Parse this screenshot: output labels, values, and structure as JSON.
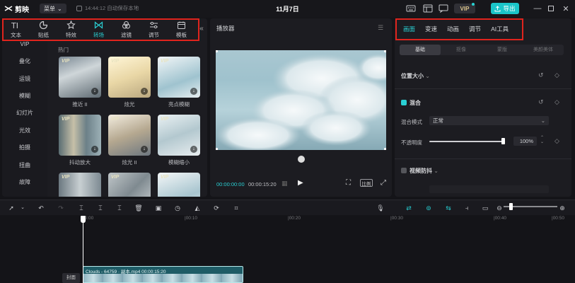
{
  "titlebar": {
    "app_name": "剪映",
    "menu_label": "菜单",
    "autosave": "14:44:12 自动保存本地",
    "date": "11月7日",
    "vip": "VIP",
    "export_label": "导出"
  },
  "left": {
    "tabs": [
      {
        "label": "文本",
        "icon": "text-icon"
      },
      {
        "label": "贴纸",
        "icon": "sticker-icon"
      },
      {
        "label": "特效",
        "icon": "effects-icon"
      },
      {
        "label": "转场",
        "icon": "transition-icon"
      },
      {
        "label": "滤镜",
        "icon": "filter-icon"
      },
      {
        "label": "调节",
        "icon": "adjust-icon"
      },
      {
        "label": "模板",
        "icon": "template-icon"
      }
    ],
    "active_tab": 3,
    "categories": [
      "VIP",
      "叠化",
      "运镜",
      "模糊",
      "幻灯片",
      "光效",
      "拍摄",
      "扭曲",
      "故障"
    ],
    "section": "热门",
    "thumbs": [
      "推近 II",
      "炫光",
      "亮点模糊",
      "抖动放大",
      "炫光 II",
      "模糊缩小"
    ],
    "vip_thumb_label": "VIP"
  },
  "player": {
    "title": "播放器",
    "time_current": "00:00:00:00",
    "time_total": "00:00:15:20",
    "ratio": "比例"
  },
  "right": {
    "tabs": [
      "画面",
      "变速",
      "动画",
      "调节",
      "AI工具"
    ],
    "subtabs": [
      "基础",
      "抠像",
      "蒙版",
      "美颜美体"
    ],
    "position_size": "位置大小",
    "blend": "混合",
    "blend_mode_label": "混合模式",
    "blend_mode_value": "正常",
    "opacity_label": "不透明度",
    "opacity_value": "100%",
    "opacity_fraction": 1.0,
    "stabilize": "视频防抖",
    "accent": "#2ad0d4"
  },
  "timeline": {
    "ticks": [
      "00:00",
      "|00:10",
      "|00:20",
      "|00:30",
      "|00:40",
      "|00:50"
    ],
    "clip_label": "Clouds - 64759 · 副本.mp4  00:00:15:20",
    "cover_label": "封面"
  }
}
